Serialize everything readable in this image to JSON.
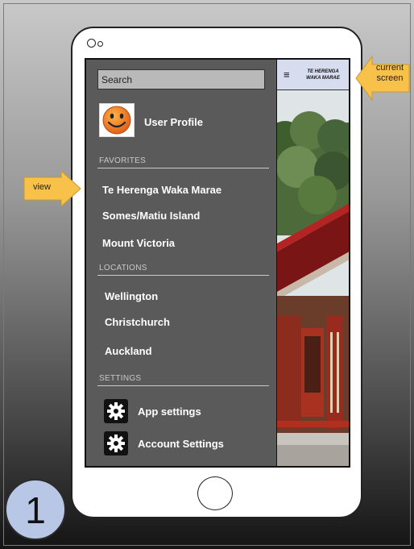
{
  "device": {
    "step_number": "1"
  },
  "drawer": {
    "search": {
      "placeholder": "Search"
    },
    "profile": {
      "label": "User Profile"
    },
    "sections": [
      {
        "heading": "FAVORITES",
        "items": [
          "Te Herenga Waka Marae",
          "Somes/Matiu Island",
          "Mount Victoria"
        ]
      },
      {
        "heading": "LOCATIONS",
        "items": [
          "Wellington",
          "Christchurch",
          "Auckland"
        ]
      },
      {
        "heading": "SETTINGS",
        "items": [
          "App settings",
          "Account Settings"
        ]
      }
    ]
  },
  "app": {
    "menu_icon": "hamburger-icon",
    "title_line1": "TE HERENGA",
    "title_line2": "WAKA MARAE"
  },
  "callouts": {
    "current_screen_line1": "current",
    "current_screen_line2": "screen",
    "view": "view"
  },
  "colors": {
    "drawer_bg": "#5a5a5a",
    "header_bg": "#d8dcef",
    "callout_fill": "#f7c14a",
    "badge_fill": "#b7c7e5",
    "marae_red": "#9e1c1c"
  }
}
